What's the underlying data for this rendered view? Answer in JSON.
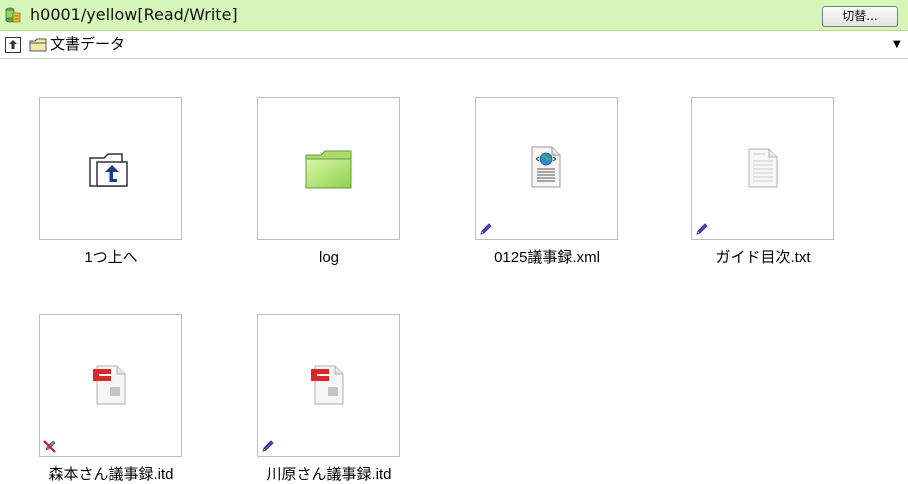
{
  "titlebar": {
    "title": "h0001/yellow[Read/Write]",
    "switch_label": "切替..."
  },
  "pathbar": {
    "path": "文書データ"
  },
  "items": [
    {
      "label": "1つ上へ",
      "icon": "folder-up-icon",
      "badge": ""
    },
    {
      "label": "log",
      "icon": "folder-icon",
      "badge": ""
    },
    {
      "label": "0125議事録.xml",
      "icon": "web-document-icon",
      "badge": "edit-pencil-icon"
    },
    {
      "label": "ガイド目次.txt",
      "icon": "text-document-icon",
      "badge": "edit-pencil-icon"
    },
    {
      "label": "森本さん議事録.itd",
      "icon": "itd-document-icon",
      "badge": "no-edit-icon"
    },
    {
      "label": "川原さん議事録.itd",
      "icon": "itd-document-icon",
      "badge": "edit-pencil-icon"
    }
  ]
}
